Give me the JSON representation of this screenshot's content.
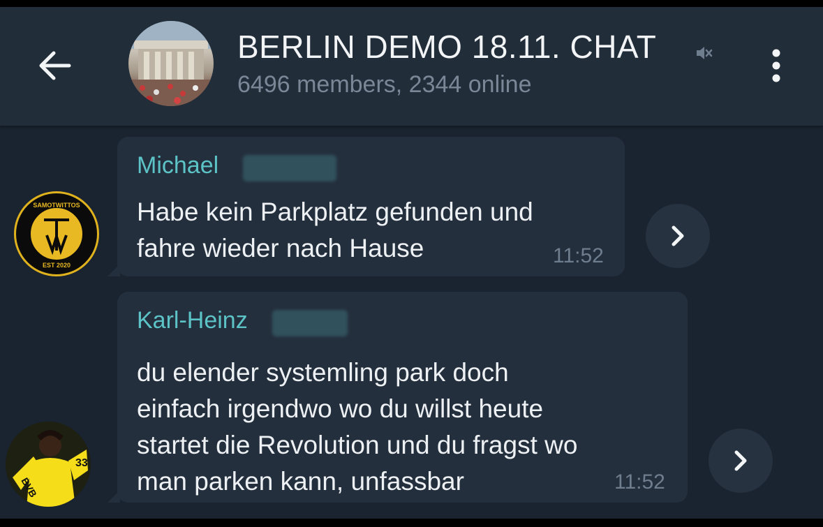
{
  "header": {
    "title": "BERLIN DEMO 18.11. CHAT",
    "subtitle": "6496 members, 2344 online",
    "back_icon": "arrow-left-icon",
    "mute_icon": "muted-speaker-icon",
    "menu_icon": "more-vertical-icon"
  },
  "messages": [
    {
      "sender": "Michael",
      "text": "Habe kein Parkplatz gefunden und\nfahre wieder nach Hause",
      "time": "11:52",
      "avatar_text": "SAMOTWITTOS",
      "avatar_badge": "EST 2020",
      "forward_icon": "chevron-right-icon"
    },
    {
      "sender": "Karl-Heinz",
      "text": "du elender systemling park doch\neinfach irgendwo wo du willst heute\nstartet die Revolution und du fragst wo\nman parken kann, unfassbar",
      "time": "11:52",
      "avatar_text": "BVB",
      "forward_icon": "chevron-right-icon"
    }
  ],
  "colors": {
    "background": "#1a2330",
    "header": "#222d3a",
    "bubble": "#242f3d",
    "sender_name": "#5cc3c6",
    "message_text": "#eef1f4",
    "timestamp": "#6f7e8f",
    "avatar_gold": "#e0b21e",
    "bvb_yellow": "#f5dd1a"
  }
}
